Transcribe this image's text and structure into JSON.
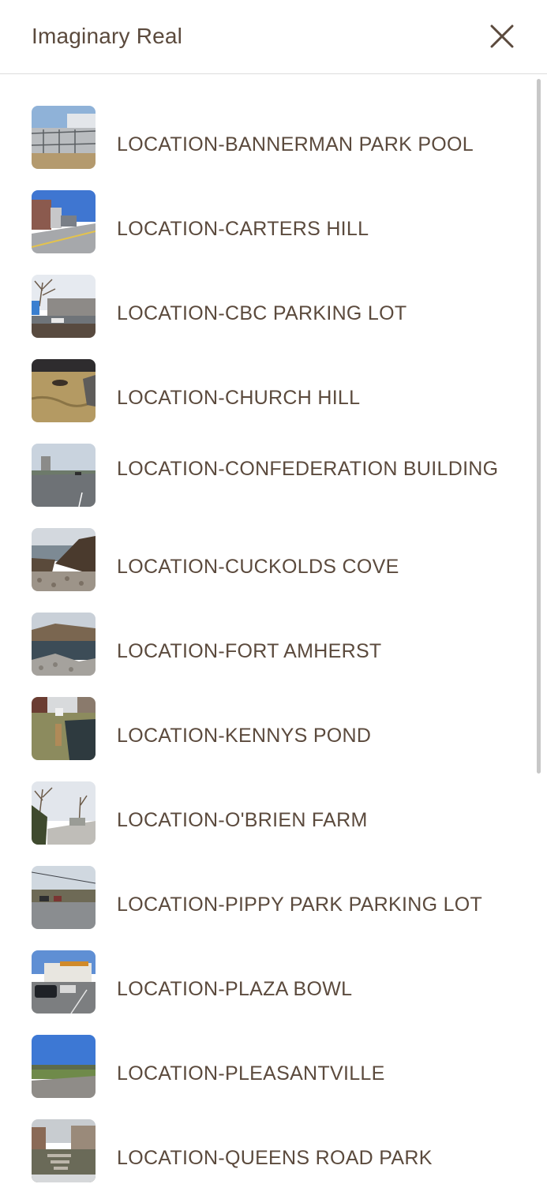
{
  "header": {
    "title": "Imaginary Real",
    "close_icon": "close-icon"
  },
  "locations": [
    {
      "label": "LOCATION-BANNERMAN PARK POOL"
    },
    {
      "label": "LOCATION-CARTERS HILL"
    },
    {
      "label": "LOCATION-CBC PARKING LOT"
    },
    {
      "label": "LOCATION-CHURCH HILL"
    },
    {
      "label": "LOCATION-CONFEDERATION BUILDING"
    },
    {
      "label": "LOCATION-CUCKOLDS COVE"
    },
    {
      "label": "LOCATION-FORT AMHERST"
    },
    {
      "label": "LOCATION-KENNYS POND"
    },
    {
      "label": "LOCATION-O'BRIEN FARM"
    },
    {
      "label": "LOCATION-PIPPY PARK PARKING LOT"
    },
    {
      "label": "LOCATION-PLAZA BOWL"
    },
    {
      "label": "LOCATION-PLEASANTVILLE"
    },
    {
      "label": "LOCATION-QUEENS ROAD PARK"
    }
  ],
  "colors": {
    "text": "#5b4a3d",
    "divider": "#dcdcdc"
  }
}
